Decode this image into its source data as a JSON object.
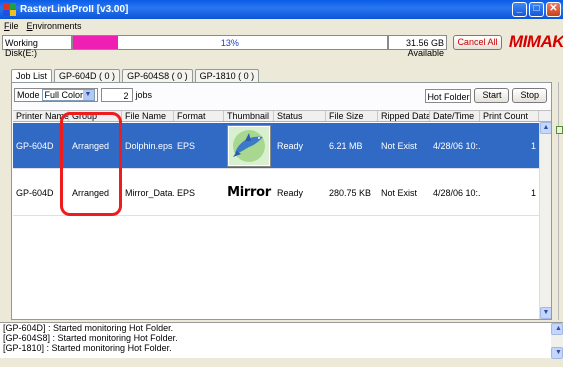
{
  "window": {
    "title": "RasterLinkProII  [v3.00]"
  },
  "menu": [
    "File",
    "Environments"
  ],
  "disk": {
    "label": "Working Disk(E:)",
    "percent": "13%",
    "fill_fraction": 0.13,
    "available": "31.56 GB Available",
    "fill_color": "#f01fb4"
  },
  "buttons": {
    "cancel_all": "Cancel All",
    "start": "Start",
    "stop": "Stop"
  },
  "logo_text": "MIMAKI",
  "tabs": [
    "Job List",
    "GP-604D ( 0 )",
    "GP-604S8 ( 0 )",
    "GP-1810 ( 0 )"
  ],
  "mode": {
    "label": "Mode",
    "value": "Full Color",
    "count": "2",
    "count_label": "jobs"
  },
  "hot_folder": {
    "label": "Hot Folder"
  },
  "table": {
    "headers": [
      "Printer Name",
      "Group",
      "File Name",
      "Format",
      "Thumbnail",
      "Status",
      "File Size",
      "Ripped Data",
      "Date/Time",
      "Print Count"
    ],
    "rows": [
      {
        "printer": "GP-604D",
        "group": "Arranged",
        "file": "Dolphin.eps",
        "format": "EPS",
        "thumb": "dolphin-image",
        "status": "Ready",
        "size": "6.21 MB",
        "ripped": "Not Exist",
        "datetime": "4/28/06 10:...",
        "count": "1"
      },
      {
        "printer": "GP-604D",
        "group": "Arranged",
        "file": "Mirror_Data...",
        "format": "EPS",
        "thumb_text": "Mirror",
        "status": "Ready",
        "size": "280.75 KB",
        "ripped": "Not Exist",
        "datetime": "4/28/06 10:...",
        "count": "1"
      }
    ]
  },
  "log": [
    "[GP-604D] : Started monitoring Hot Folder.",
    "[GP-604S8] : Started monitoring Hot Folder.",
    "[GP-1810] : Started monitoring Hot Folder."
  ],
  "colors": {
    "selection": "#316ac5",
    "highlight": "#ee1c1c",
    "accent": "#d40000"
  }
}
